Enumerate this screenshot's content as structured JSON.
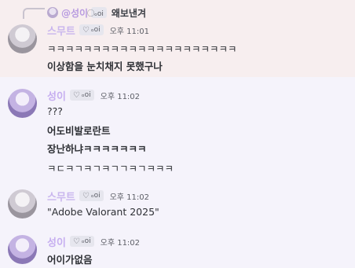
{
  "reply": {
    "name": "@성이",
    "badge_text": "⃝ₒoi",
    "text": "왜보낸겨"
  },
  "messages": [
    {
      "username": "스무트",
      "badge": "ₒoi",
      "time": "오후 11:01",
      "lines": [
        "ㅋㅋㅋㅋㅋㅋㅋㅋㅋㅋㅋㅋㅋㅋㅋㅋㅋㅋㅋㅋㅋ",
        "이상함을 눈치채지 못했구나"
      ]
    },
    {
      "username": "성이",
      "badge": "ₒoi",
      "time": "오후 11:02",
      "lines": [
        "???",
        "어도비발로란트",
        "장난하냐ㅋㅋㅋㅋㅋㅋㅋ",
        "ㅋㄷㅋㄱㅋㄱㅋㄱㄱㅋㄱㅋㅋㅋ"
      ]
    },
    {
      "username": "스무트",
      "badge": "ₒoi",
      "time": "오후 11:02",
      "lines": [
        "\"Adobe Valorant 2025\""
      ]
    },
    {
      "username": "성이",
      "badge": "ₒoi",
      "time": "오후 11:02",
      "lines": [
        "어이가없음"
      ]
    }
  ],
  "colors": {
    "background": "#f5f3fb",
    "highlight": "#f7eeef",
    "username": "#c9b6ee"
  },
  "icons": {
    "badge": "heart-outline-icon",
    "avatar": "anime-avatar"
  }
}
